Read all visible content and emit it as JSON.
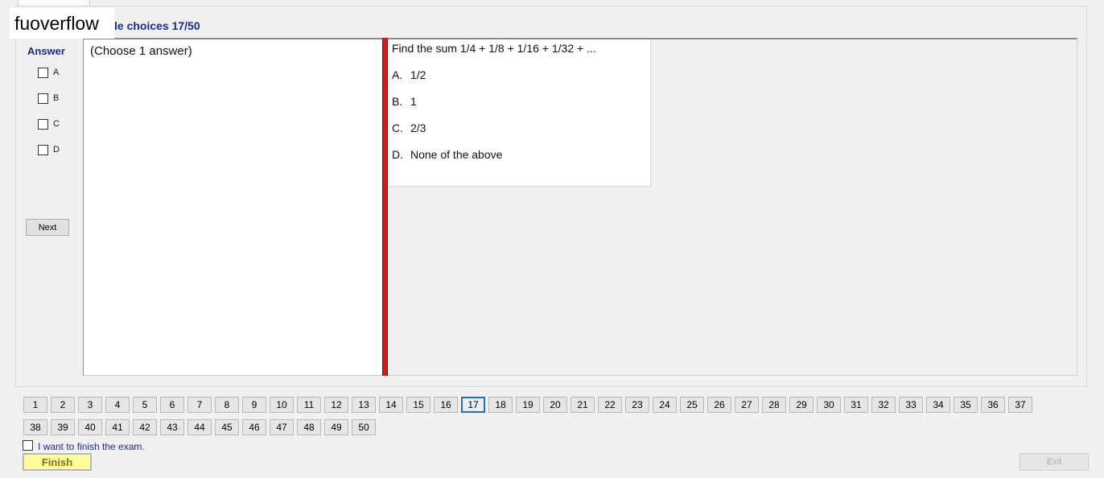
{
  "watermark": "fuoverflow",
  "section_title": "le choices 17/50",
  "answer_panel": {
    "heading": "Answer",
    "options": [
      "A",
      "B",
      "C",
      "D"
    ],
    "next_label": "Next"
  },
  "instruction": "(Choose 1 answer)",
  "question": {
    "text": "Find the sum 1/4 + 1/8 + 1/16 + 1/32 + ...",
    "choices": [
      {
        "letter": "A.",
        "text": "1/2"
      },
      {
        "letter": "B.",
        "text": "1"
      },
      {
        "letter": "C.",
        "text": "2/3"
      },
      {
        "letter": "D.",
        "text": "None of the above"
      }
    ]
  },
  "navigation": {
    "current": 17,
    "numbers": [
      "1",
      "2",
      "3",
      "4",
      "5",
      "6",
      "7",
      "8",
      "9",
      "10",
      "11",
      "12",
      "13",
      "14",
      "15",
      "16",
      "17",
      "18",
      "19",
      "20",
      "21",
      "22",
      "23",
      "24",
      "25",
      "26",
      "27",
      "28",
      "29",
      "30",
      "31",
      "32",
      "33",
      "34",
      "35",
      "36",
      "37",
      "38",
      "39",
      "40",
      "41",
      "42",
      "43",
      "44",
      "45",
      "46",
      "47",
      "48",
      "49",
      "50"
    ]
  },
  "footer": {
    "finish_checkbox_label": "I want to finish the exam.",
    "finish_label": "Finish",
    "exit_label": "Exit"
  }
}
